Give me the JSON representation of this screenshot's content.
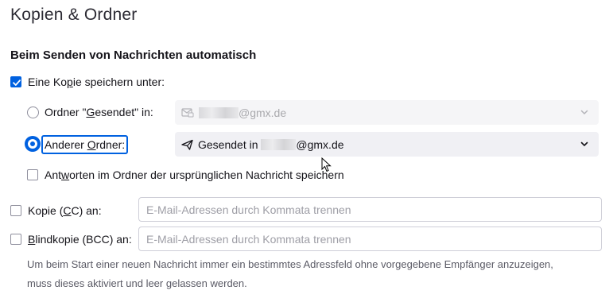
{
  "page": {
    "title": "Kopien & Ordner"
  },
  "section": {
    "heading": "Beim Senden von Nachrichten automatisch"
  },
  "copy": {
    "enabled": true,
    "label_pre": "Eine Ko",
    "label_key": "p",
    "label_post": "ie speichern unter:"
  },
  "sent_folder": {
    "selected": false,
    "label_pre": "Ordner \"",
    "label_key": "G",
    "label_post": "esendet\" in:",
    "dropdown_value": "@gmx.de",
    "icon": "mail-account-icon"
  },
  "other_folder": {
    "selected": true,
    "label_pre": "Anderer ",
    "label_key": "O",
    "label_post": "rdner:",
    "dropdown_prefix": "Gesendet in ",
    "dropdown_value": "@gmx.de",
    "icon": "send-arrow-icon"
  },
  "reply_folder": {
    "checked": false,
    "label_pre": "Ant",
    "label_key": "w",
    "label_post": "orten im Ordner der ursprünglichen Nachricht speichern"
  },
  "cc": {
    "checked": false,
    "label_pre": "Kopie (",
    "label_key": "C",
    "label_post": "C) an:",
    "placeholder": "E-Mail-Adressen durch Kommata trennen",
    "value": ""
  },
  "bcc": {
    "checked": false,
    "label_pre": "",
    "label_key": "B",
    "label_post": "lindkopie (BCC) an:",
    "placeholder": "E-Mail-Adressen durch Kommata trennen",
    "value": ""
  },
  "hint": {
    "line1": "Um beim Start einer neuen Nachricht immer ein bestimmtes Adressfeld ohne vorgegebene Empfänger anzuzeigen,",
    "line2": "muss dieses aktiviert und leer gelassen werden."
  },
  "colors": {
    "accent": "#0061e0",
    "dropdown_bg": "#f0f0f4",
    "text": "#15141a",
    "muted": "#5b5b66"
  }
}
